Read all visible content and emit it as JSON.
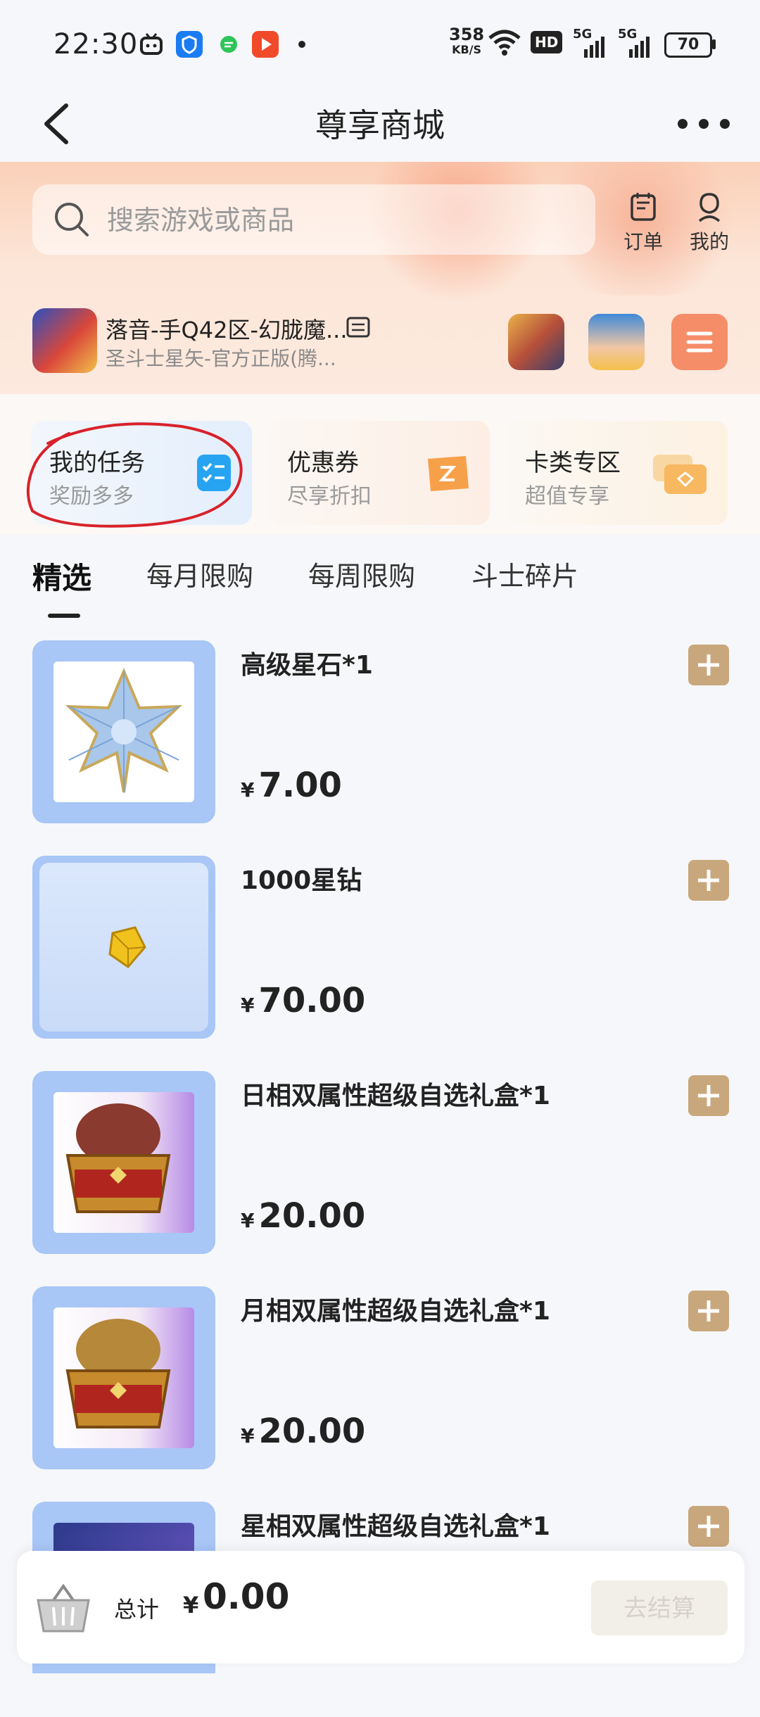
{
  "status_bar": {
    "time": "22:30",
    "net_speed_value": "358",
    "net_speed_unit": "KB/S",
    "hd_label": "HD",
    "sim1_label": "5G",
    "sim2_label": "5G",
    "battery": "70"
  },
  "nav": {
    "title": "尊享商城"
  },
  "search": {
    "placeholder": "搜索游戏或商品"
  },
  "top_actions": {
    "orders_label": "订单",
    "mine_label": "我的"
  },
  "current_game": {
    "server_name": "落音-手Q42区-幻胧魔...",
    "game_title": "圣斗士星矢-官方正版(腾..."
  },
  "feature_cards": [
    {
      "title": "我的任务",
      "subtitle": "奖励多多"
    },
    {
      "title": "优惠券",
      "subtitle": "尽享折扣"
    },
    {
      "title": "卡类专区",
      "subtitle": "超值专享"
    }
  ],
  "tabs": [
    "精选",
    "每月限购",
    "每周限购",
    "斗士碎片"
  ],
  "active_tab_index": 0,
  "products": [
    {
      "name": "高级星石*1",
      "currency": "¥",
      "price": "7.00"
    },
    {
      "name": "1000星钻",
      "currency": "¥",
      "price": "70.00"
    },
    {
      "name": "日相双属性超级自选礼盒*1",
      "currency": "¥",
      "price": "20.00"
    },
    {
      "name": "月相双属性超级自选礼盒*1",
      "currency": "¥",
      "price": "20.00"
    },
    {
      "name": "星相双属性超级自选礼盒*1",
      "currency": "¥",
      "price": ""
    }
  ],
  "bottom_bar": {
    "total_label": "总计",
    "currency": "¥",
    "total_value": "0.00",
    "checkout_label": "去结算"
  },
  "colors": {
    "accent_gold": "#c9a77c",
    "menu_orange": "#f58d68",
    "annotation_red": "#d8222b"
  }
}
